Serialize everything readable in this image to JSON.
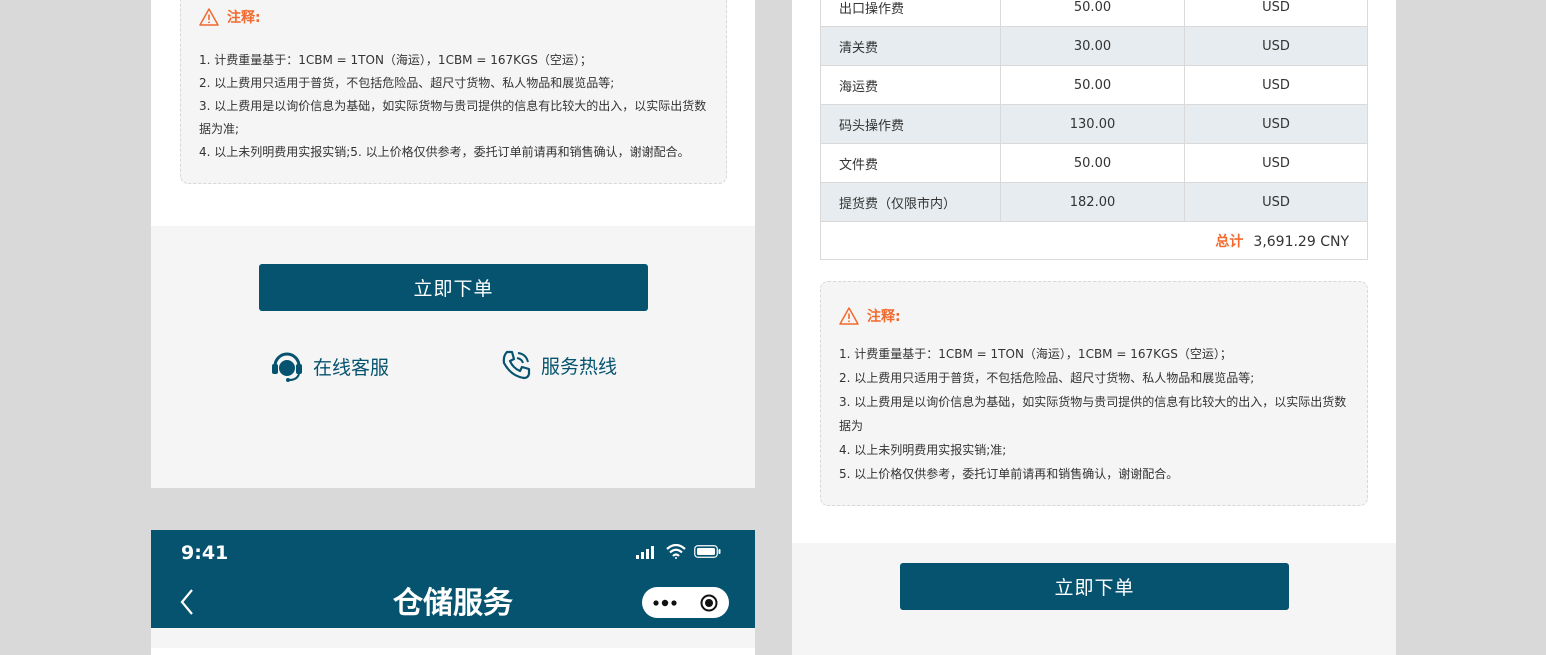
{
  "left_panel": {
    "note_title": "注释:",
    "note_lines": [
      "1. 计费重量基于：1CBM = 1TON（海运），1CBM = 167KGS（空运）；",
      "2. 以上费用只适用于普货，不包括危险品、超尺寸货物、私人物品和展览品等;",
      "3. 以上费用是以询价信息为基础，如实际货物与贵司提供的信息有比较大的出入，以实际出货数据为准;",
      "4. 以上未列明费用实报实销;5. 以上价格仅供参考，委托订单前请再和销售确认，谢谢配合。"
    ],
    "order_button": "立即下单",
    "online_service": "在线客服",
    "hotline": "服务热线"
  },
  "mobile_header": {
    "time": "9:41",
    "title": "仓储服务"
  },
  "right_panel": {
    "fees": [
      {
        "name": "出口操作费",
        "amount": "50.00",
        "currency": "USD"
      },
      {
        "name": "清关费",
        "amount": "30.00",
        "currency": "USD"
      },
      {
        "name": "海运费",
        "amount": "50.00",
        "currency": "USD"
      },
      {
        "name": "码头操作费",
        "amount": "130.00",
        "currency": "USD"
      },
      {
        "name": "文件费",
        "amount": "50.00",
        "currency": "USD"
      },
      {
        "name": "提货费（仅限市内）",
        "amount": "182.00",
        "currency": "USD"
      }
    ],
    "total_label": "总计",
    "total_value": "3,691.29 CNY",
    "note_title": "注释:",
    "note_lines": [
      "1. 计费重量基于：1CBM = 1TON（海运），1CBM = 167KGS（空运）；",
      "2. 以上费用只适用于普货，不包括危险品、超尺寸货物、私人物品和展览品等;",
      "3. 以上费用是以询价信息为基础，如实际货物与贵司提供的信息有比较大的出入，以实际出货数据为",
      "4. 以上未列明费用实报实销;准;",
      "5. 以上价格仅供参考，委托订单前请再和销售确认，谢谢配合。"
    ],
    "order_button": "立即下单"
  },
  "colors": {
    "primary": "#05536f",
    "accent": "#f26a2e",
    "row_shade": "#e6ecef"
  },
  "icons": [
    "warning-icon",
    "headset-icon",
    "phone-icon",
    "signal-icon",
    "wifi-icon",
    "battery-icon",
    "back-icon",
    "more-icon",
    "target-icon"
  ]
}
